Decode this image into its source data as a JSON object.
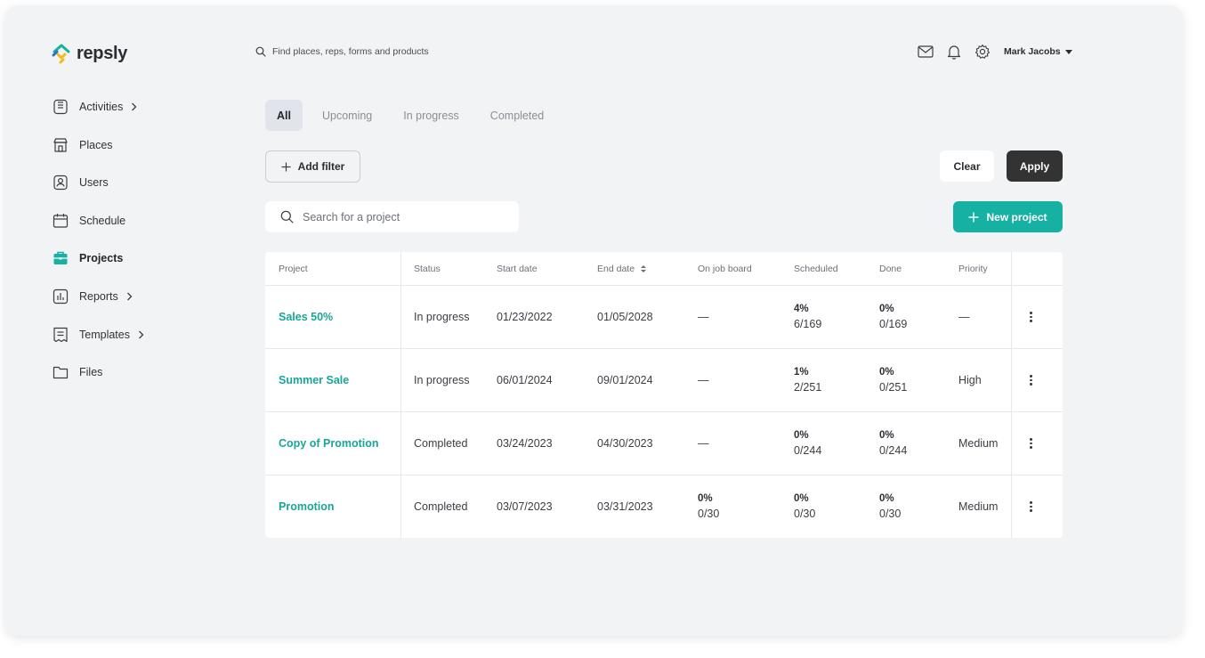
{
  "app": {
    "name": "repsly"
  },
  "header": {
    "search_placeholder": "Find places, reps, forms and products",
    "user_name": "Mark Jacobs",
    "icons": [
      "mail-icon",
      "bell-icon",
      "gear-icon"
    ]
  },
  "sidebar": {
    "items": [
      {
        "label": "Activities",
        "icon": "clipboard-icon",
        "has_submenu": true
      },
      {
        "label": "Places",
        "icon": "store-icon",
        "has_submenu": false
      },
      {
        "label": "Users",
        "icon": "user-badge-icon",
        "has_submenu": false
      },
      {
        "label": "Schedule",
        "icon": "calendar-icon",
        "has_submenu": false
      },
      {
        "label": "Projects",
        "icon": "briefcase-icon",
        "has_submenu": false,
        "active": true
      },
      {
        "label": "Reports",
        "icon": "bar-chart-icon",
        "has_submenu": true
      },
      {
        "label": "Templates",
        "icon": "template-icon",
        "has_submenu": true
      },
      {
        "label": "Files",
        "icon": "folder-icon",
        "has_submenu": false
      }
    ]
  },
  "tabs": [
    {
      "label": "All",
      "active": true
    },
    {
      "label": "Upcoming"
    },
    {
      "label": "In progress"
    },
    {
      "label": "Completed"
    }
  ],
  "toolbar": {
    "add_filter": "Add filter",
    "clear": "Clear",
    "apply": "Apply",
    "search_placeholder": "Search for a project",
    "new_project": "New project"
  },
  "colors": {
    "accent": "#17b1a4",
    "link": "#17a697",
    "apply_bg": "#333333"
  },
  "table": {
    "columns": [
      "Project",
      "Status",
      "Start date",
      "End date",
      "On job board",
      "Scheduled",
      "Done",
      "Priority"
    ],
    "rows": [
      {
        "project": "Sales 50%",
        "status": "In progress",
        "start": "01/23/2022",
        "end": "01/05/2028",
        "job_pct": "—",
        "job_frac": "",
        "sched_pct": "4%",
        "sched_frac": "6/169",
        "done_pct": "0%",
        "done_frac": "0/169",
        "priority": "—"
      },
      {
        "project": "Summer Sale",
        "status": "In progress",
        "start": "06/01/2024",
        "end": "09/01/2024",
        "job_pct": "—",
        "job_frac": "",
        "sched_pct": "1%",
        "sched_frac": "2/251",
        "done_pct": "0%",
        "done_frac": "0/251",
        "priority": "High"
      },
      {
        "project": "Copy of Promotion",
        "status": "Completed",
        "start": "03/24/2023",
        "end": "04/30/2023",
        "job_pct": "—",
        "job_frac": "",
        "sched_pct": "0%",
        "sched_frac": "0/244",
        "done_pct": "0%",
        "done_frac": "0/244",
        "priority": "Medium"
      },
      {
        "project": "Promotion",
        "status": "Completed",
        "start": "03/07/2023",
        "end": "03/31/2023",
        "job_pct": "0%",
        "job_frac": "0/30",
        "sched_pct": "0%",
        "sched_frac": "0/30",
        "done_pct": "0%",
        "done_frac": "0/30",
        "priority": "Medium"
      }
    ]
  }
}
